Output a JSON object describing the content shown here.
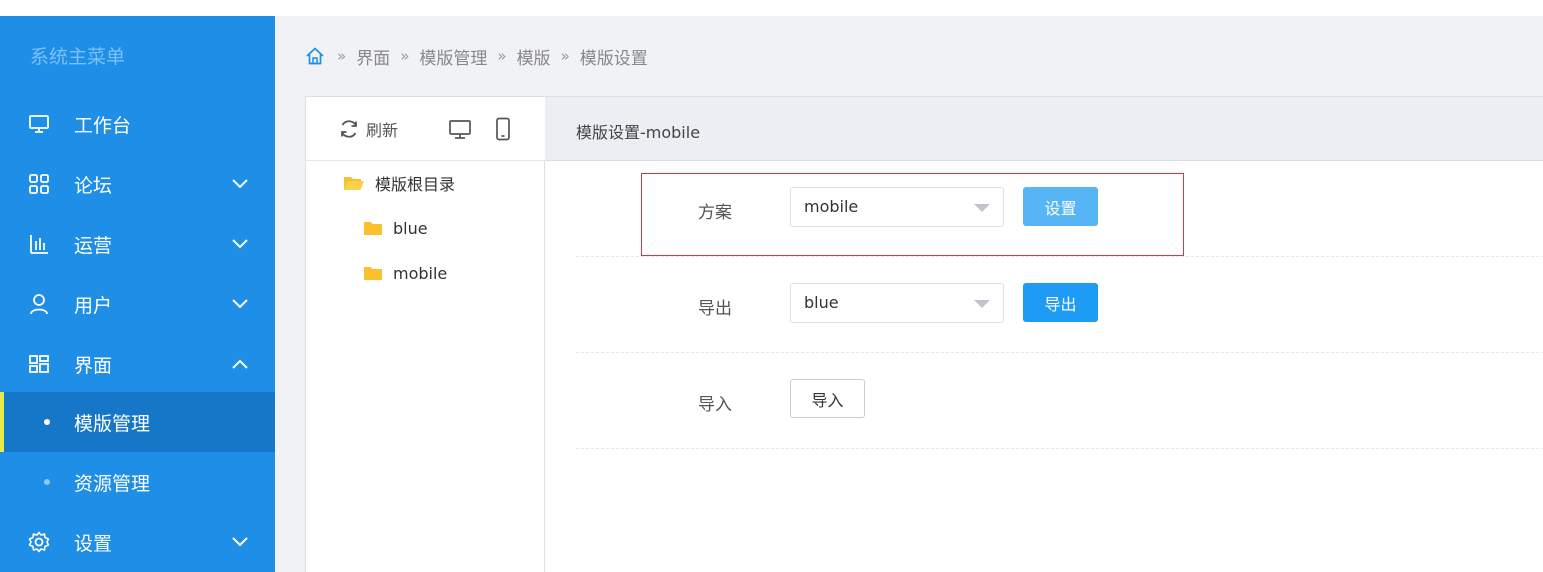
{
  "sidebar": {
    "title": "系统主菜单",
    "items": [
      {
        "label": "工作台",
        "icon": "monitor-icon"
      },
      {
        "label": "论坛",
        "icon": "grid-icon"
      },
      {
        "label": "运营",
        "icon": "bar-chart-icon"
      },
      {
        "label": "用户",
        "icon": "user-icon"
      },
      {
        "label": "界面",
        "icon": "layout-icon"
      },
      {
        "label": "设置",
        "icon": "gear-icon"
      }
    ],
    "sub_items": [
      {
        "label": "模版管理"
      },
      {
        "label": "资源管理"
      }
    ]
  },
  "breadcrumb": {
    "items": [
      "界面",
      "模版管理",
      "模版",
      "模版设置"
    ],
    "separator": "»"
  },
  "tree": {
    "refresh_label": "刷新",
    "root": "模版根目录",
    "children": [
      "blue",
      "mobile"
    ]
  },
  "main": {
    "title": "模版设置-mobile",
    "rows": [
      {
        "label": "方案",
        "select_value": "mobile",
        "button": "设置"
      },
      {
        "label": "导出",
        "select_value": "blue",
        "button": "导出"
      },
      {
        "label": "导入",
        "button": "导入"
      }
    ]
  },
  "colors": {
    "sidebar_bg": "#1e8ee6",
    "active_item_bg": "#1677c9",
    "primary": "#1e9bf5",
    "highlight_border": "#d9383b"
  }
}
